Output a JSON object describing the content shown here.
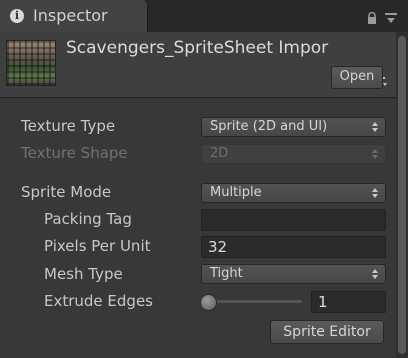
{
  "tab": {
    "label": "Inspector",
    "icon": "info-icon"
  },
  "header": {
    "title": "Scavengers_SpriteSheet Impor",
    "open_label": "Open",
    "help_icon": "?"
  },
  "properties": {
    "texture_type": {
      "label": "Texture Type",
      "value": "Sprite (2D and UI)"
    },
    "texture_shape": {
      "label": "Texture Shape",
      "value": "2D"
    },
    "sprite_mode": {
      "label": "Sprite Mode",
      "value": "Multiple"
    },
    "packing_tag": {
      "label": "Packing Tag",
      "value": ""
    },
    "pixels_per_unit": {
      "label": "Pixels Per Unit",
      "value": "32"
    },
    "mesh_type": {
      "label": "Mesh Type",
      "value": "Tight"
    },
    "extrude_edges": {
      "label": "Extrude Edges",
      "value": "1",
      "slider_fraction": 0.03
    }
  },
  "buttons": {
    "sprite_editor": "Sprite Editor"
  },
  "colors": {
    "background": "#383838",
    "header": "#3f3f3f",
    "tabbar": "#282828"
  }
}
